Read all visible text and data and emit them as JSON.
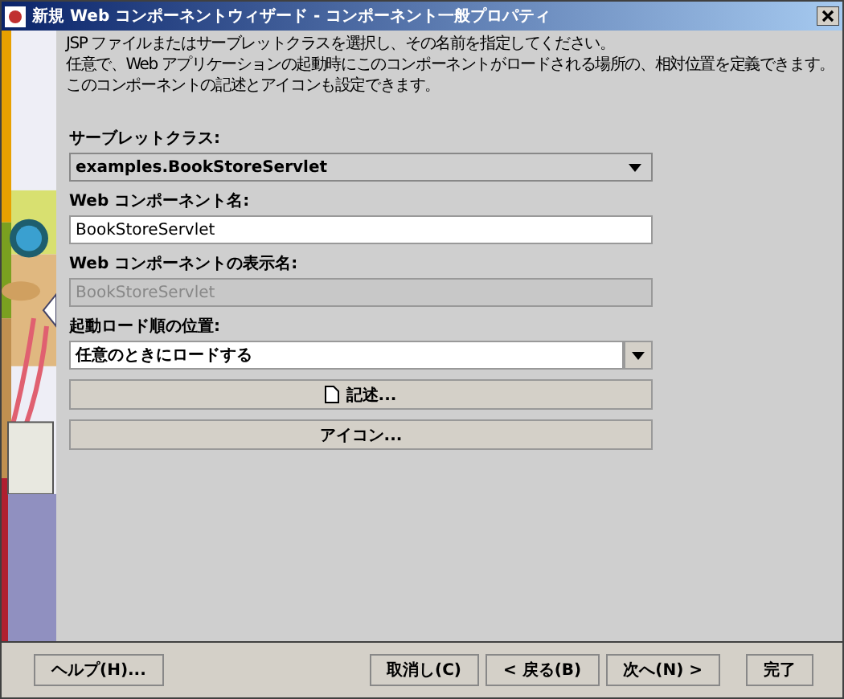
{
  "window": {
    "title": "新規 Web コンポーネントウィザード - コンポーネント一般プロパティ"
  },
  "instructions": [
    "JSP ファイルまたはサーブレットクラスを選択し、その名前を指定してください。",
    "任意で、Web アプリケーションの起動時にこのコンポーネントがロードされる場所の、相対位置を定義できます。",
    "このコンポーネントの記述とアイコンも設定できます。"
  ],
  "fields": [
    {
      "kind": "select",
      "label": "サーブレットクラス:",
      "value": "examples.BookStoreServlet"
    },
    {
      "kind": "text",
      "label": "Web コンポーネント名:",
      "value": "BookStoreServlet",
      "disabled": false
    },
    {
      "kind": "text",
      "label": "Web コンポーネントの表示名:",
      "value": "BookStoreServlet",
      "disabled": true
    },
    {
      "kind": "combo",
      "label": "起動ロード順の位置:",
      "value": "任意のときにロードする"
    }
  ],
  "buttons": [
    {
      "kind": "document",
      "label": "記述..."
    },
    {
      "kind": "plain",
      "label": "アイコン..."
    }
  ],
  "footer": {
    "left": [
      {
        "label": "ヘルプ(H)..."
      }
    ],
    "right": [
      {
        "label": "取消し(C)"
      },
      {
        "label": "< 戻る(B)"
      },
      {
        "label": "次へ(N) >"
      },
      {
        "label": "完了"
      }
    ]
  }
}
